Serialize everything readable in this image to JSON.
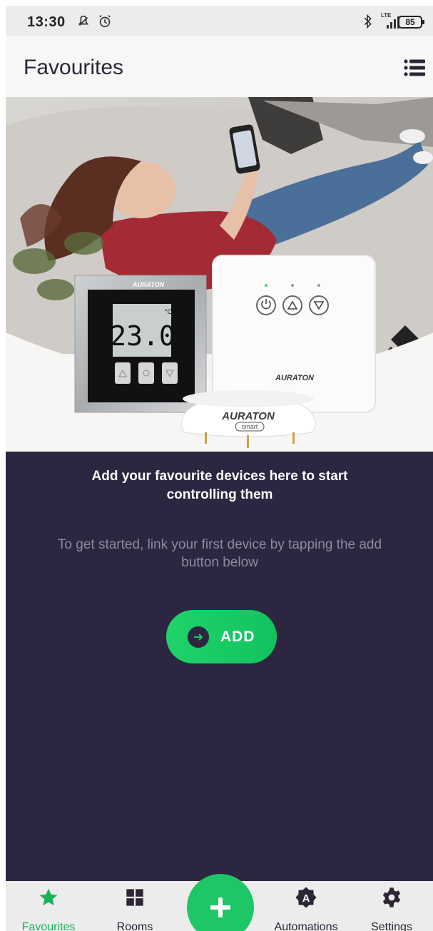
{
  "status_bar": {
    "time": "13:30",
    "battery": "85",
    "network": "LTE"
  },
  "header": {
    "title": "Favourites"
  },
  "hero": {
    "thermostat_display": "23.0",
    "thermostat_unit": "°C",
    "brand_large": "AURATON",
    "brand_small": "smart"
  },
  "empty_state": {
    "heading": "Add your favourite devices here to start controlling them",
    "subtext": "To get started, link your first device by tapping the add button below",
    "add_label": "ADD"
  },
  "bottom_nav": {
    "items": [
      {
        "label": "Favourites",
        "icon": "star-icon",
        "active": true
      },
      {
        "label": "Rooms",
        "icon": "grid-icon",
        "active": false
      },
      {
        "label": "Automations",
        "icon": "automation-icon",
        "active": false
      },
      {
        "label": "Settings",
        "icon": "gear-icon",
        "active": false
      }
    ]
  },
  "colors": {
    "accent": "#1ec766",
    "panel": "#2c2640",
    "active_nav": "#1bb35a"
  }
}
